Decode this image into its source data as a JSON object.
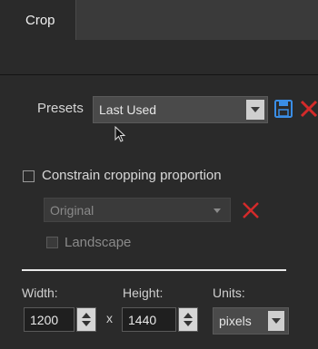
{
  "tabs": [
    {
      "label": "Crop",
      "active": true
    }
  ],
  "presets": {
    "label": "Presets",
    "selected": "Last Used"
  },
  "constrain": {
    "label": "Constrain cropping proportion",
    "checked": false,
    "ratio_selected": "Original",
    "landscape_label": "Landscape",
    "landscape_checked": false
  },
  "size": {
    "width_label": "Width:",
    "width_value": "1200",
    "times_symbol": "x",
    "height_label": "Height:",
    "height_value": "1440",
    "units_label": "Units:",
    "units_selected": "pixels"
  },
  "icons": {
    "save": "floppy-disk-icon",
    "delete": "x-icon",
    "cursor": "mouse-pointer-icon"
  },
  "colors": {
    "accent_blue": "#3a8ee6",
    "delete_red": "#d42a2a",
    "panel_bg": "#2a2a2a"
  }
}
